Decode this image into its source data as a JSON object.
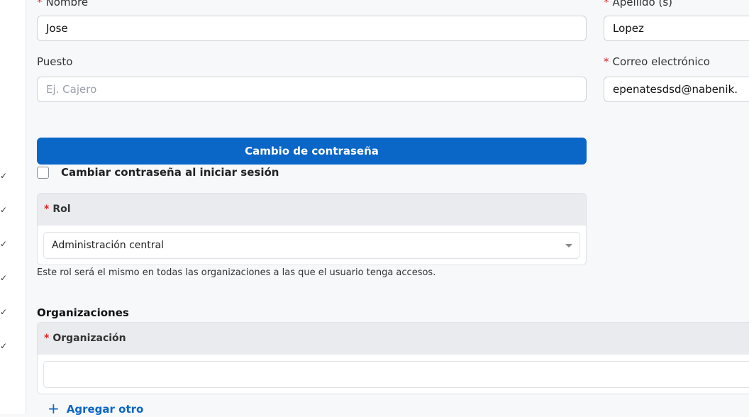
{
  "sidebar": {
    "check_icons": [
      "✓",
      "✓",
      "✓",
      "✓",
      "✓",
      "✓"
    ]
  },
  "form": {
    "nombre": {
      "label": "Nombre",
      "value": "Jose"
    },
    "apellido": {
      "label": "Apellido (s)",
      "value": "Lopez"
    },
    "puesto": {
      "label": "Puesto",
      "placeholder": "Ej. Cajero"
    },
    "correo": {
      "label": "Correo electrónico",
      "value": "epenatesdsd@nabenik."
    },
    "required_mark": "*"
  },
  "password": {
    "button_label": "Cambio de contraseña",
    "checkbox_label": "Cambiar contraseña al iniciar sesión",
    "checkbox_checked": false
  },
  "rol": {
    "header": "Rol",
    "selected": "Administración central",
    "help": "Este rol será el mismo en todas las organizaciones a las que el usuario tenga accesos."
  },
  "organizaciones": {
    "title": "Organizaciones",
    "header": "Organización",
    "value": "",
    "add_label": "Agregar otro"
  },
  "colors": {
    "primary": "#0a66c7",
    "required": "#e02424",
    "background": "#f7f8fa"
  }
}
